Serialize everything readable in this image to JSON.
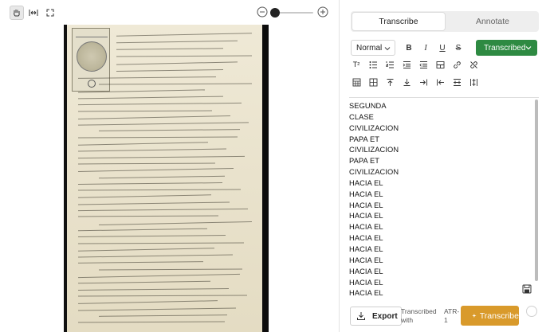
{
  "tabs": [
    {
      "label": "Transcribe",
      "active": true
    },
    {
      "label": "Annotate",
      "active": false
    }
  ],
  "editor": {
    "style_value": "Normal",
    "bold_label": "B",
    "italic_label": "I",
    "underline_label": "U",
    "strike_label": "S",
    "superscript_label": "T²",
    "status_label": "Transcribed"
  },
  "viewer": {
    "zoom_level": 0.72
  },
  "transcription_lines": [
    "SEGUNDA",
    "CLASE",
    "CIVILIZACION",
    "PAPA ET",
    "CIVILIZACION",
    "PAPA ET",
    "CIVILIZACION",
    "HACIA EL",
    "HACIA EL",
    "HACIA EL",
    "HACIA EL",
    "HACIA EL",
    "HACIA EL",
    "HACIA EL",
    "HACIA EL",
    "HACIA EL",
    "HACIA EL",
    "HACIA EL",
    "HACIA EL"
  ],
  "bottom": {
    "export_label": "Export",
    "transcribed_with_label": "Transcribed with",
    "model_label": "ATR-1",
    "transcribe_label": "Transcribe"
  },
  "colors": {
    "status_green": "#2e8a42",
    "transcribe_orange": "#d99a2b"
  }
}
